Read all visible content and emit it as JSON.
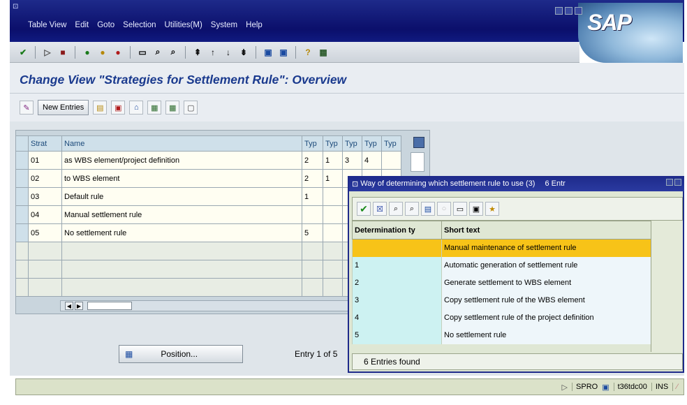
{
  "menu": [
    "Table View",
    "Edit",
    "Goto",
    "Selection",
    "Utilities(M)",
    "System",
    "Help"
  ],
  "brand": "SAP",
  "page_title": "Change View \"Strategies for Settlement Rule\": Overview",
  "app_toolbar": {
    "new_entries": "New Entries"
  },
  "main_table": {
    "headers": [
      "Strat",
      "Name",
      "Typ",
      "Typ",
      "Typ",
      "Typ",
      "Typ"
    ],
    "rows": [
      [
        "01",
        "as WBS element/project definition",
        "2",
        "1",
        "3",
        "4",
        ""
      ],
      [
        "02",
        "to WBS element",
        "2",
        "1",
        "",
        "",
        ""
      ],
      [
        "03",
        "Default rule",
        "1",
        "",
        "",
        "",
        ""
      ],
      [
        "04",
        "Manual settlement rule",
        "",
        "",
        "",
        "",
        ""
      ],
      [
        "05",
        "No settlement rule",
        "5",
        "",
        "",
        "",
        ""
      ]
    ]
  },
  "position_button": "Position...",
  "entry_text": "Entry 1 of 5",
  "status": {
    "tcode": "SPRO",
    "server": "t36tdc00",
    "mode": "INS"
  },
  "popup": {
    "title": "Way of determining which settlement rule to use (3)",
    "count": "6 Entr",
    "headers": [
      "Determination ty",
      "Short text"
    ],
    "rows": [
      [
        "",
        "Manual maintenance of settlement rule"
      ],
      [
        "1",
        "Automatic generation of settlement rule"
      ],
      [
        "2",
        "Generate settlement to WBS element"
      ],
      [
        "3",
        "Copy settlement rule of the WBS element"
      ],
      [
        "4",
        "Copy settlement rule of the project definition"
      ],
      [
        "5",
        "No settlement rule"
      ]
    ],
    "footer": "6 Entries found"
  },
  "colors": {
    "title_bar": "#0b0f6b",
    "title_text": "#1a3a8e",
    "highlight": "#f7c318"
  }
}
